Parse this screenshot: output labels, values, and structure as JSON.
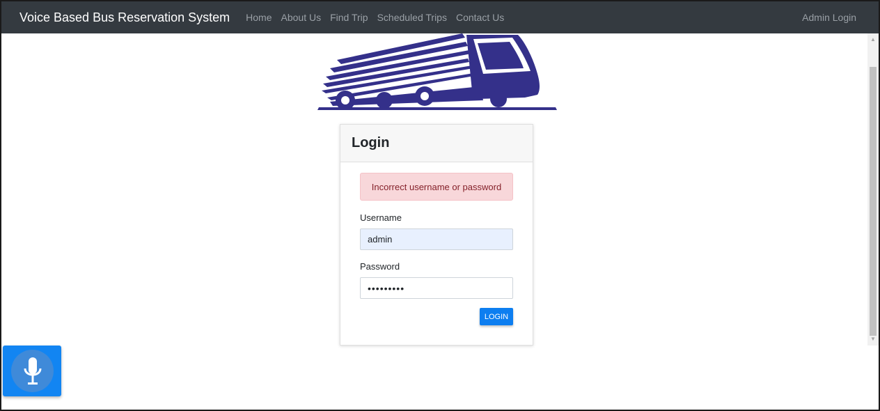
{
  "navbar": {
    "brand": "Voice Based Bus Reservation System",
    "links": [
      "Home",
      "About Us",
      "Find Trip",
      "Scheduled Trips",
      "Contact Us"
    ],
    "right_link": "Admin Login"
  },
  "login": {
    "title": "Login",
    "alert": "Incorrect username or password",
    "username_label": "Username",
    "username_value": "admin",
    "password_label": "Password",
    "password_value": "•••••••••",
    "button_label": "LOGIN"
  },
  "colors": {
    "navbar_bg": "#343a40",
    "logo_color": "#34308a",
    "button_bg": "#0d7ef0",
    "alert_bg": "#f8d7da"
  },
  "icons": {
    "logo": "bus-logo",
    "mic": "microphone-icon"
  }
}
